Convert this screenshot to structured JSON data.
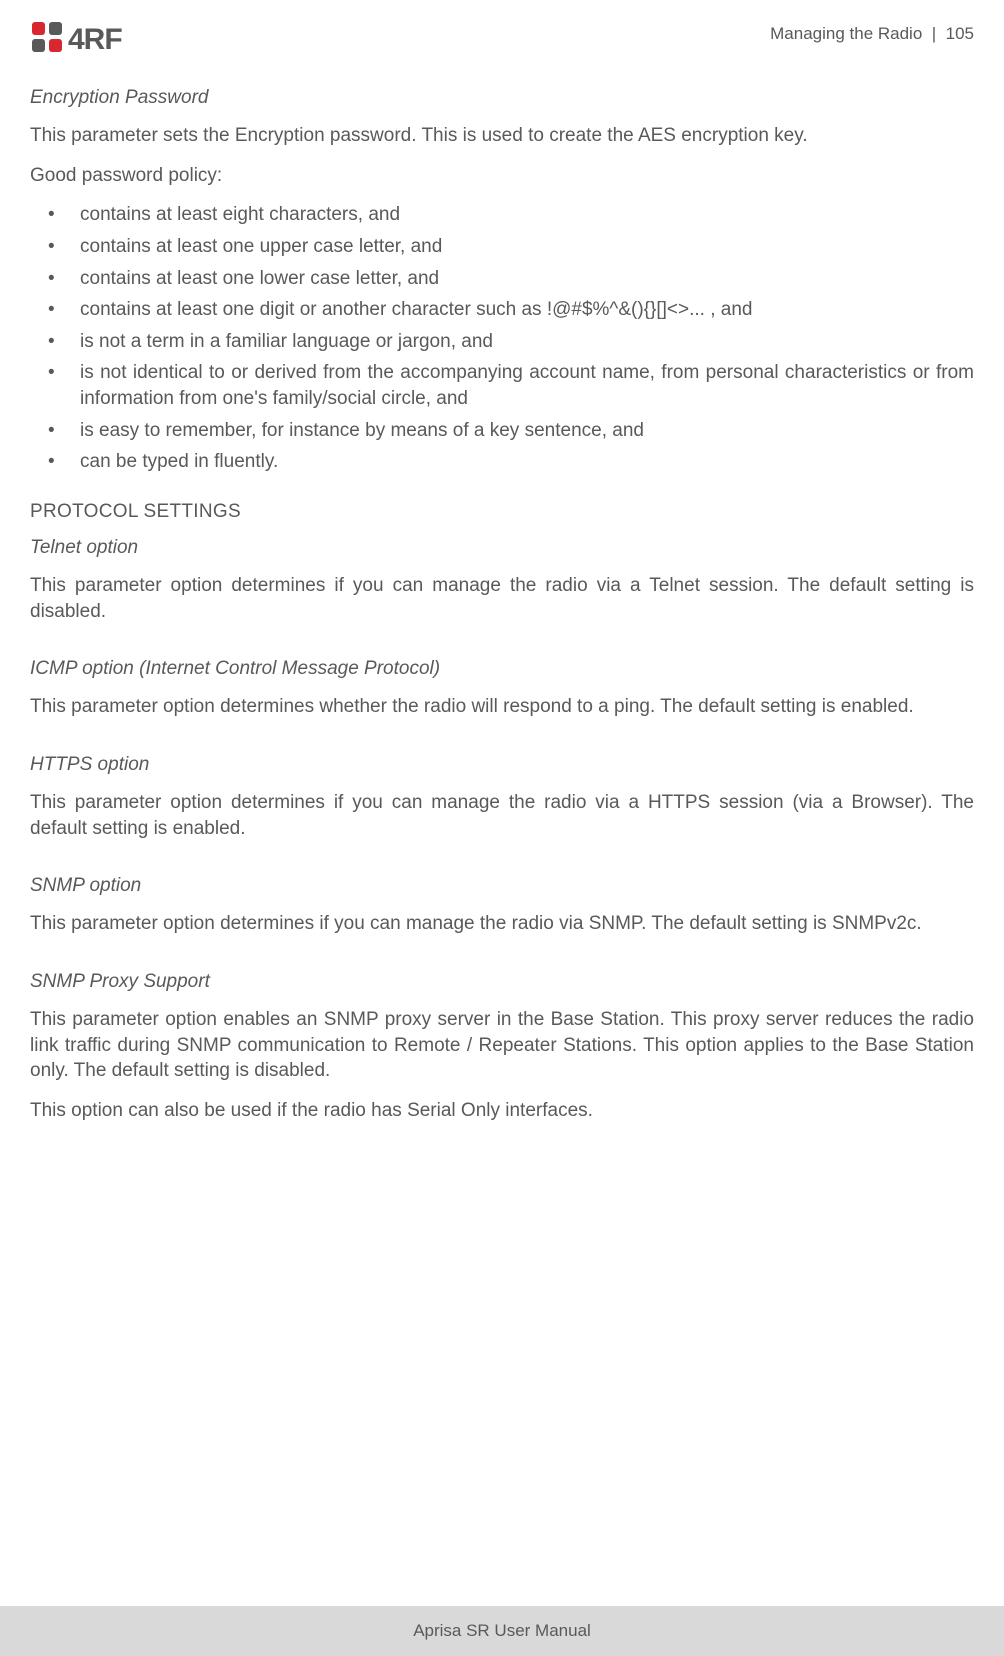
{
  "header": {
    "logo_text": "4RF",
    "section": "Managing the Radio",
    "sep": "|",
    "page_number": "105"
  },
  "encryption": {
    "heading": "Encryption Password",
    "intro": "This parameter sets the Encryption password. This is used to create the AES encryption key.",
    "policy_label": "Good password policy:",
    "bullets": [
      "contains at least eight characters, and",
      "contains at least one upper case letter, and",
      "contains at least one lower case letter, and",
      "contains at least one digit or another character such as  !@#$%^&(){}[]<>... , and",
      "is not a term in a familiar language or jargon, and",
      "is not identical to or derived from the accompanying account name, from personal characteristics or from information from one's family/social circle, and",
      "is easy to remember, for instance by means of a key sentence, and",
      "can be typed in fluently."
    ]
  },
  "protocol": {
    "heading": "PROTOCOL SETTINGS",
    "telnet": {
      "heading": "Telnet option",
      "text": "This parameter option determines if you can manage the radio via a Telnet session. The default setting is disabled."
    },
    "icmp": {
      "heading": "ICMP option (Internet Control Message Protocol)",
      "text": "This parameter option determines whether the radio will respond to a ping. The default setting is enabled."
    },
    "https": {
      "heading": "HTTPS option",
      "text": "This parameter option determines if you can manage the radio via a HTTPS session (via a Browser). The default setting is enabled."
    },
    "snmp": {
      "heading": "SNMP option",
      "text": "This parameter option determines if you can manage the radio via SNMP. The default setting is SNMPv2c."
    },
    "proxy": {
      "heading": "SNMP Proxy Support",
      "text1": "This parameter option enables an SNMP proxy server in the Base Station. This proxy server reduces the radio link traffic during SNMP communication to Remote / Repeater Stations. This option applies to the Base Station only. The default setting is disabled.",
      "text2": "This option can also be used if the radio has Serial Only interfaces."
    }
  },
  "footer": {
    "text": "Aprisa SR User Manual"
  }
}
